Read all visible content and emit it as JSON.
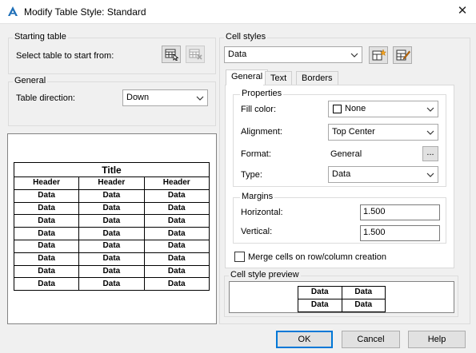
{
  "window": {
    "title": "Modify Table Style: Standard"
  },
  "starting_table": {
    "group_label": "Starting table",
    "select_label": "Select table to start from:"
  },
  "general": {
    "group_label": "General",
    "direction_label": "Table direction:",
    "direction_value": "Down"
  },
  "preview": {
    "title": "Title",
    "headers": [
      "Header",
      "Header",
      "Header"
    ],
    "rows": [
      [
        "Data",
        "Data",
        "Data"
      ],
      [
        "Data",
        "Data",
        "Data"
      ],
      [
        "Data",
        "Data",
        "Data"
      ],
      [
        "Data",
        "Data",
        "Data"
      ],
      [
        "Data",
        "Data",
        "Data"
      ],
      [
        "Data",
        "Data",
        "Data"
      ],
      [
        "Data",
        "Data",
        "Data"
      ],
      [
        "Data",
        "Data",
        "Data"
      ]
    ]
  },
  "cell_styles": {
    "group_label": "Cell styles",
    "selected": "Data",
    "tabs": [
      "General",
      "Text",
      "Borders"
    ],
    "properties": {
      "group_label": "Properties",
      "fill_color_label": "Fill color:",
      "fill_color_value": "None",
      "alignment_label": "Alignment:",
      "alignment_value": "Top Center",
      "format_label": "Format:",
      "format_value": "General",
      "format_button": "...",
      "type_label": "Type:",
      "type_value": "Data"
    },
    "margins": {
      "group_label": "Margins",
      "horizontal_label": "Horizontal:",
      "horizontal_value": "1.500",
      "vertical_label": "Vertical:",
      "vertical_value": "1.500"
    },
    "merge_label": "Merge cells on row/column creation",
    "merge_checked": false,
    "cell_preview": {
      "group_label": "Cell style preview",
      "rows": [
        [
          "Data",
          "Data"
        ],
        [
          "Data",
          "Data"
        ]
      ]
    }
  },
  "buttons": {
    "ok": "OK",
    "cancel": "Cancel",
    "help": "Help"
  },
  "colors": {
    "accent": "#0078d7",
    "app_icon": "#1e6fb8"
  }
}
